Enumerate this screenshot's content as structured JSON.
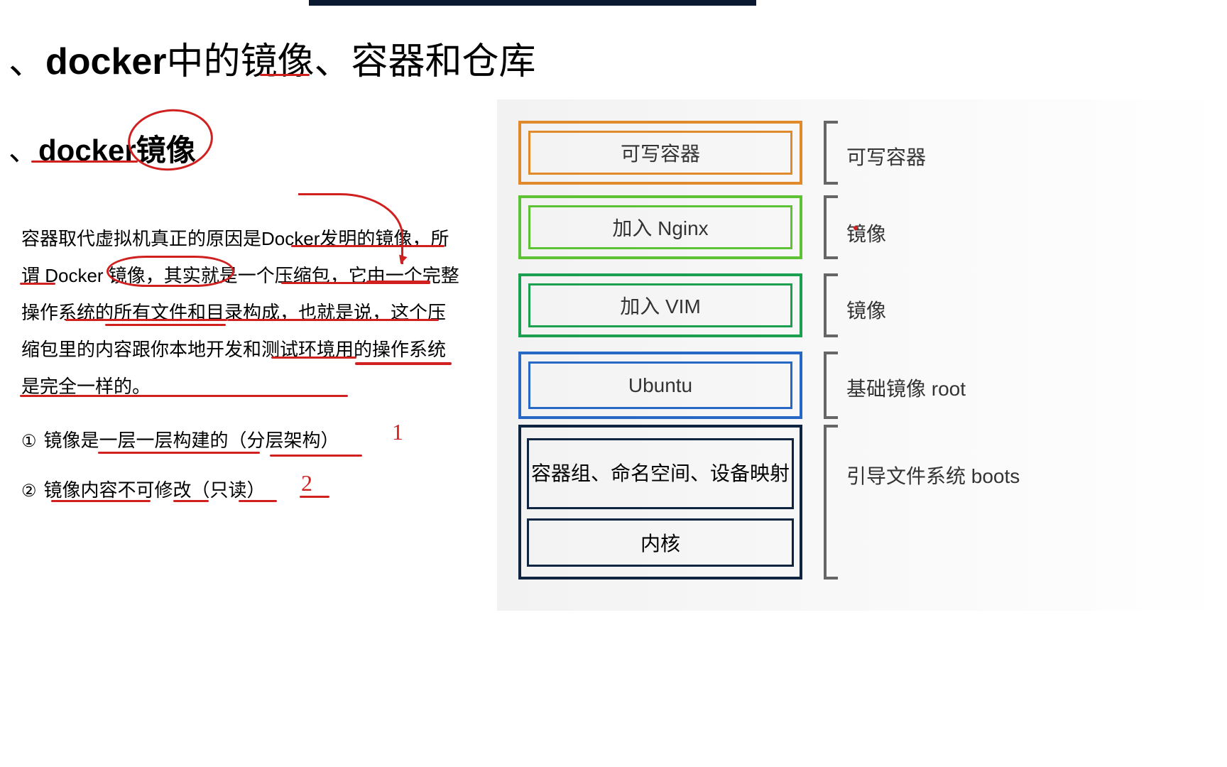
{
  "main_title_prefix": "、",
  "main_title_bold": "docker",
  "main_title_rest": "中的镜像、容器和仓库",
  "section_prefix": "、",
  "section_bold": "docker镜像",
  "paragraph_text": "容器取代虚拟机真正的原因是Docker发明的镜像，所谓 Docker 镜像，其实就是一个压缩包，它由一个完整操作系统的所有文件和目录构成，也就是说，这个压缩包里的内容跟你本地开发和测试环境用的操作系统是完全一样的。",
  "point1_num": "①",
  "point1_text": "镜像是一层一层构建的（分层架构）",
  "point2_num": "②",
  "point2_text": "镜像内容不可修改（只读）",
  "red_mark_1": "1",
  "red_mark_2": "2",
  "diagram": {
    "layer1": "可写容器",
    "layer2": "加入 Nginx",
    "layer3": "加入  VIM",
    "layer4": "Ubuntu",
    "layer5a": "容器组、命名空间、设备映射",
    "layer5b": "内核",
    "label1": "可写容器",
    "label2": "镜像",
    "label3": "镜像",
    "label4": "基础镜像 root",
    "label5": "引导文件系统 boots"
  }
}
